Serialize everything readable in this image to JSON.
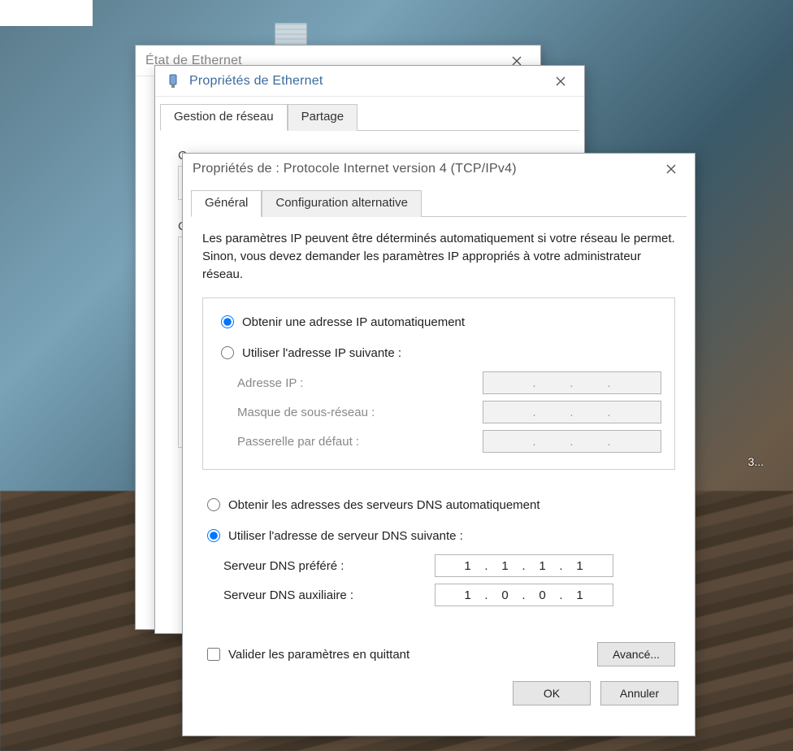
{
  "win1": {
    "title": "État de Ethernet"
  },
  "win2": {
    "title": "Propriétés de Ethernet",
    "tabs": {
      "t1": "Gestion de réseau",
      "t2": "Partage"
    },
    "connLabelPrefix": "Co",
    "listHeaderPrefix": "Ce"
  },
  "win3": {
    "title": "Propriétés de : Protocole Internet version 4 (TCP/IPv4)",
    "tabs": {
      "t1": "Général",
      "t2": "Configuration alternative"
    },
    "intro": "Les paramètres IP peuvent être déterminés automatiquement si votre réseau le permet. Sinon, vous devez demander les paramètres IP appropriés à votre administrateur réseau.",
    "radio1": "Obtenir une adresse IP automatiquement",
    "radio2": "Utiliser l'adresse IP suivante :",
    "ip_label": "Adresse IP :",
    "mask_label": "Masque de sous-réseau :",
    "gw_label": "Passerelle par défaut :",
    "radio3": "Obtenir les adresses des serveurs DNS automatiquement",
    "radio4": "Utiliser l'adresse de serveur DNS suivante :",
    "dns1_label": "Serveur DNS préféré :",
    "dns2_label": "Serveur DNS auxiliaire :",
    "dns1": {
      "o1": "1",
      "o2": "1",
      "o3": "1",
      "o4": "1"
    },
    "dns2": {
      "o1": "1",
      "o2": "0",
      "o3": "0",
      "o4": "1"
    },
    "validate": "Valider les paramètres en quittant",
    "advanced": "Avancé...",
    "ok": "OK",
    "cancel": "Annuler"
  },
  "desk": {
    "truncated": "3..."
  },
  "dots": {
    "d": "."
  }
}
